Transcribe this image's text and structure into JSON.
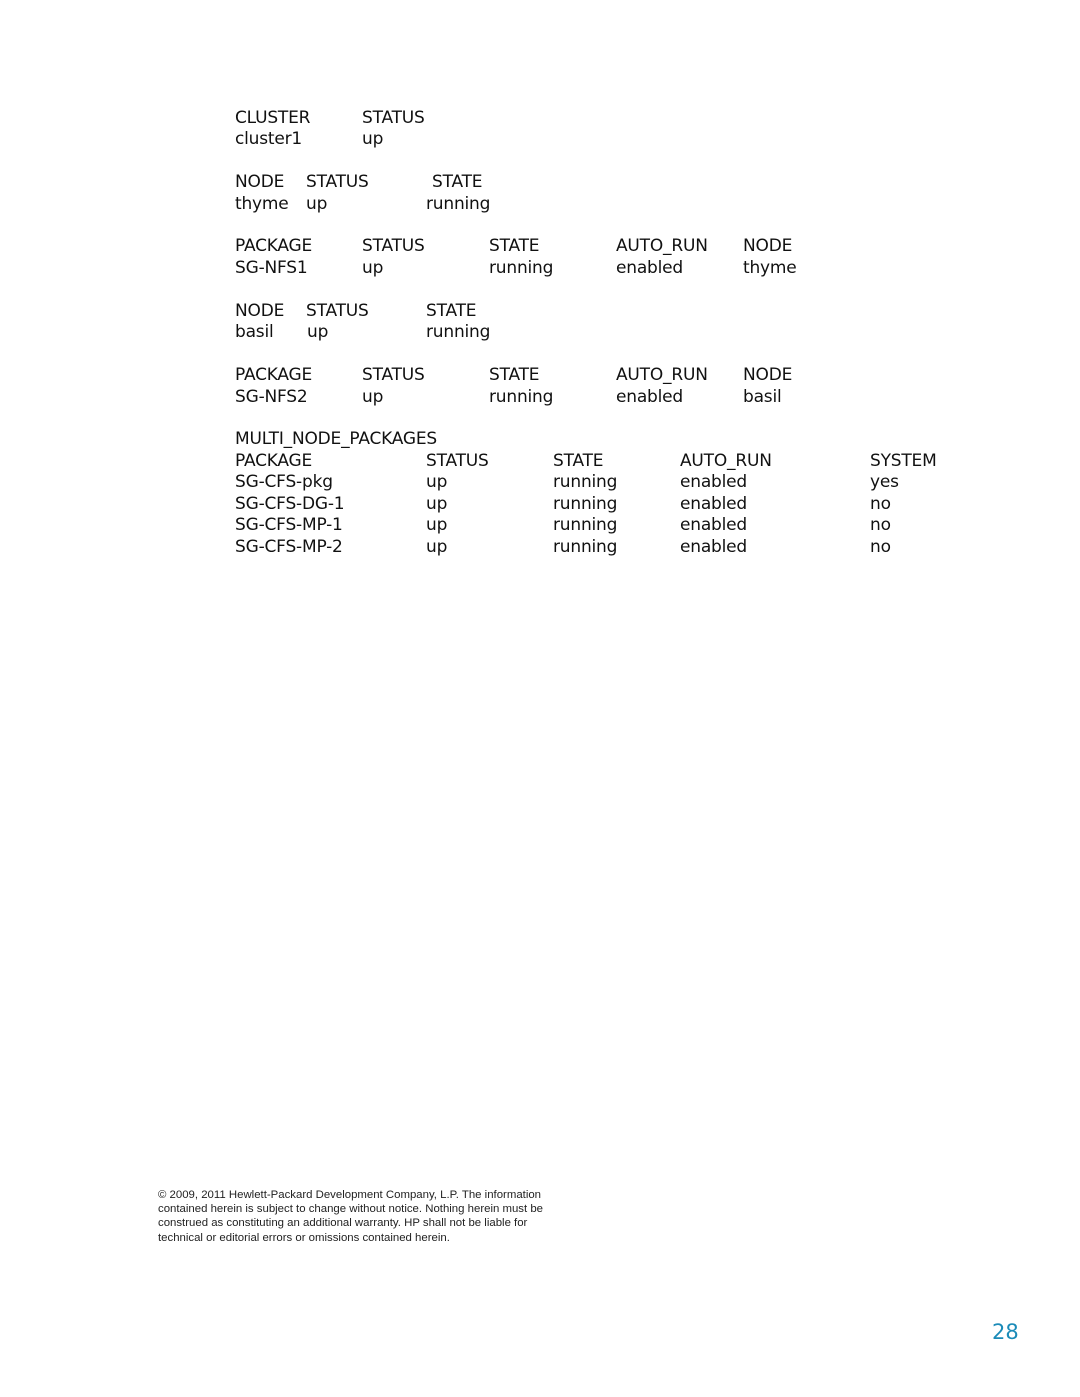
{
  "cluster_table": {
    "headers": [
      "CLUSTER",
      "STATUS"
    ],
    "rows": [
      [
        "cluster1",
        "up"
      ]
    ]
  },
  "node_table_1": {
    "headers": [
      "NODE",
      "STATUS",
      "STATE"
    ],
    "rows": [
      [
        "thyme",
        "up",
        "running"
      ]
    ]
  },
  "package_table_1": {
    "headers": [
      "PACKAGE",
      "STATUS",
      "STATE",
      "AUTO_RUN",
      "NODE"
    ],
    "rows": [
      [
        "SG-NFS1",
        "up",
        "running",
        "enabled",
        "thyme"
      ]
    ]
  },
  "node_table_2": {
    "headers": [
      "NODE",
      "STATUS",
      "STATE"
    ],
    "rows": [
      [
        "basil",
        "up",
        "running"
      ]
    ]
  },
  "package_table_2": {
    "headers": [
      "PACKAGE",
      "STATUS",
      "STATE",
      "AUTO_RUN",
      "NODE"
    ],
    "rows": [
      [
        "SG-NFS2",
        "up",
        "running",
        "enabled",
        "basil"
      ]
    ]
  },
  "multi_node_packages": {
    "title": "MULTI_NODE_PACKAGES",
    "headers": [
      "PACKAGE",
      "STATUS",
      "STATE",
      "AUTO_RUN",
      "SYSTEM"
    ],
    "rows": [
      [
        "SG-CFS-pkg",
        "up",
        "running",
        "enabled",
        "yes"
      ],
      [
        "SG-CFS-DG-1",
        "up",
        "running",
        "enabled",
        "no"
      ],
      [
        "SG-CFS-MP-1",
        "up",
        "running",
        "enabled",
        "no"
      ],
      [
        "SG-CFS-MP-2",
        "up",
        "running",
        "enabled",
        "no"
      ]
    ]
  },
  "footer": {
    "lines": [
      "© 2009, 2011 Hewlett-Packard Development Company, L.P. The information",
      "contained herein is subject to change without notice. Nothing herein must be",
      "construed as constituting an additional warranty. HP shall not be liable for",
      "technical or editorial errors or omissions contained herein."
    ]
  },
  "page_number": "28",
  "colors": {
    "page_number": "#1b8bb8",
    "text": "#111111"
  }
}
